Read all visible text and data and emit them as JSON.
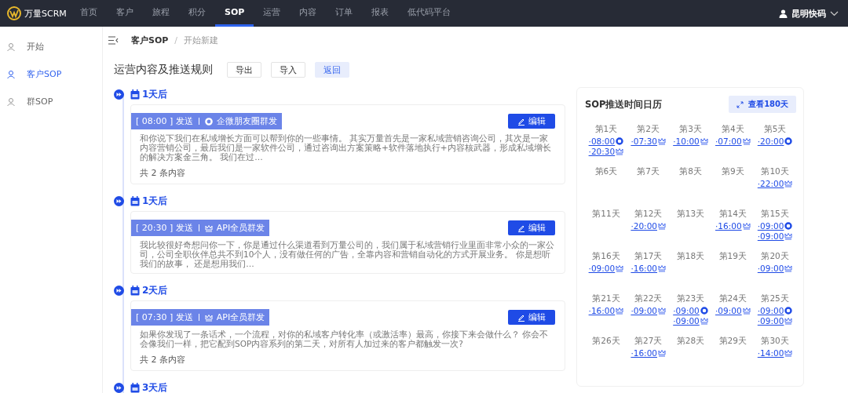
{
  "brand": {
    "name": "万量SCRM"
  },
  "nav": [
    {
      "label": "首页",
      "selected": false
    },
    {
      "label": "客户",
      "selected": false
    },
    {
      "label": "旅程",
      "selected": false
    },
    {
      "label": "积分",
      "selected": false
    },
    {
      "label": "SOP",
      "selected": true
    },
    {
      "label": "运营",
      "selected": false
    },
    {
      "label": "内容",
      "selected": false
    },
    {
      "label": "订单",
      "selected": false
    },
    {
      "label": "报表",
      "selected": false
    },
    {
      "label": "低代码平台",
      "selected": false
    }
  ],
  "user": {
    "name": "昆明快码"
  },
  "sidebar": {
    "items": [
      {
        "label": "开始",
        "selected": false
      },
      {
        "label": "客户SOP",
        "selected": true
      },
      {
        "label": "群SOP",
        "selected": false
      }
    ]
  },
  "breadcrumb": {
    "separator": "/",
    "items": [
      "客户SOP",
      "开始新建"
    ]
  },
  "page_title": "运营内容及推送规则",
  "actions": [
    {
      "label": "导出",
      "kind": "plain"
    },
    {
      "label": "导入",
      "kind": "plain"
    },
    {
      "label": "返回",
      "kind": "primary"
    }
  ],
  "timeline": [
    {
      "day": "1天后",
      "time": "[ 08:00 ] 发送",
      "channel": "企微朋友圈群发",
      "kind": "moments",
      "edit": "编辑",
      "text": "和你说下我们在私域增长方面可以帮到你的一些事情。 其实万量首先是一家私域营销咨询公司，其次是一家内容营销公司，最后我们是一家软件公司，通过咨询出方案策略+软件落地执行+内容核武器，形成私域增长的解决方案金三角。 我们在过…",
      "count": "共 2 条内容"
    },
    {
      "day": "1天后",
      "time": "[ 20:30 ] 发送",
      "channel": "API全员群发",
      "kind": "api",
      "edit": "编辑",
      "text": "我比较很好奇想问你一下，你是通过什么渠道看到万量公司的，我们属于私域营销行业里面非常小众的一家公司，公司全职伙伴总共不到10个人，没有做任何的广告，全靠内容和营销自动化的方式开展业务。 你是想听我们的故事， 还是想用我们…"
    },
    {
      "day": "2天后",
      "time": "[ 07:30 ] 发送",
      "channel": "API全员群发",
      "kind": "api",
      "edit": "编辑",
      "text": "如果你发现了一条话术，一个流程，对你的私域客户转化率（或激活率）最高，你接下来会做什么？ 你会不会像我们一样，把它配到SOP内容系列的第二天，对所有人加过来的客户都触发一次?",
      "count": "共 2 条内容"
    },
    {
      "day": "3天后"
    }
  ],
  "calendar": {
    "title": "SOP推送时间日历",
    "expand": "查看180天",
    "days": [
      {
        "label": "第1天",
        "entries": [
          {
            "time": "·08:00",
            "kind": "moments"
          },
          {
            "time": "·20:30",
            "kind": "api"
          }
        ]
      },
      {
        "label": "第2天",
        "entries": [
          {
            "time": "·07:30",
            "kind": "api"
          }
        ]
      },
      {
        "label": "第3天",
        "entries": [
          {
            "time": "·10:00",
            "kind": "api"
          }
        ]
      },
      {
        "label": "第4天",
        "entries": [
          {
            "time": "·07:00",
            "kind": "api"
          }
        ]
      },
      {
        "label": "第5天",
        "entries": [
          {
            "time": "·20:00",
            "kind": "moments"
          }
        ]
      },
      {
        "label": "第6天"
      },
      {
        "label": "第7天"
      },
      {
        "label": "第8天"
      },
      {
        "label": "第9天"
      },
      {
        "label": "第10天",
        "entries": [
          {
            "time": "·22:00",
            "kind": "api"
          }
        ]
      },
      {
        "label": "第11天"
      },
      {
        "label": "第12天",
        "entries": [
          {
            "time": "·20:00",
            "kind": "api"
          }
        ]
      },
      {
        "label": "第13天"
      },
      {
        "label": "第14天",
        "entries": [
          {
            "time": "·16:00",
            "kind": "api"
          }
        ]
      },
      {
        "label": "第15天",
        "entries": [
          {
            "time": "·09:00",
            "kind": "moments"
          },
          {
            "time": "·09:00",
            "kind": "api"
          }
        ]
      },
      {
        "label": "第16天",
        "entries": [
          {
            "time": "·09:00",
            "kind": "api"
          }
        ]
      },
      {
        "label": "第17天",
        "entries": [
          {
            "time": "·16:00",
            "kind": "api"
          }
        ]
      },
      {
        "label": "第18天"
      },
      {
        "label": "第19天"
      },
      {
        "label": "第20天",
        "entries": [
          {
            "time": "·09:00",
            "kind": "api"
          }
        ]
      },
      {
        "label": "第21天",
        "entries": [
          {
            "time": "·16:00",
            "kind": "api"
          }
        ]
      },
      {
        "label": "第22天",
        "entries": [
          {
            "time": "·09:00",
            "kind": "api"
          }
        ]
      },
      {
        "label": "第23天",
        "entries": [
          {
            "time": "·09:00",
            "kind": "moments"
          },
          {
            "time": "·09:00",
            "kind": "api"
          }
        ]
      },
      {
        "label": "第24天",
        "entries": [
          {
            "time": "·09:00",
            "kind": "api"
          }
        ]
      },
      {
        "label": "第25天",
        "entries": [
          {
            "time": "·09:00",
            "kind": "moments"
          },
          {
            "time": "·09:00",
            "kind": "api"
          }
        ]
      },
      {
        "label": "第26天"
      },
      {
        "label": "第27天",
        "entries": [
          {
            "time": "·16:00",
            "kind": "api"
          }
        ]
      },
      {
        "label": "第28天"
      },
      {
        "label": "第29天"
      },
      {
        "label": "第30天",
        "entries": [
          {
            "time": "·14:00",
            "kind": "api"
          }
        ]
      }
    ]
  }
}
